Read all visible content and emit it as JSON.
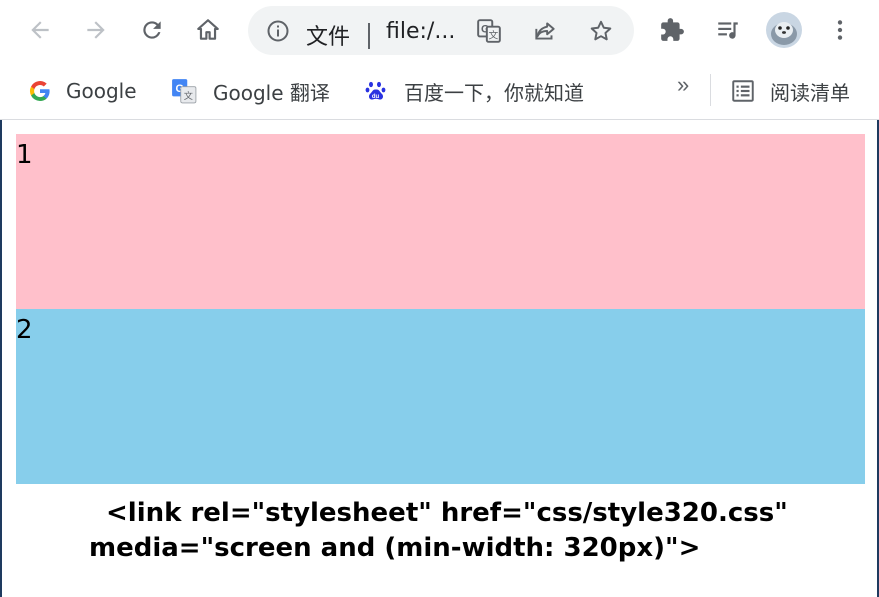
{
  "toolbar": {
    "back_icon": "arrow-left-icon",
    "forward_icon": "arrow-right-icon",
    "reload_icon": "reload-icon",
    "home_icon": "home-icon",
    "omnibox": {
      "info_icon": "info-icon",
      "scheme_label": "文件",
      "url_text": "file:/...",
      "translate_icon": "translate-icon",
      "share_icon": "share-icon",
      "bookmark_star_icon": "star-icon"
    },
    "extensions_icon": "puzzle-icon",
    "media_icon": "media-playlist-icon",
    "avatar_icon": "profile-avatar",
    "menu_icon": "kebab-menu-icon"
  },
  "bookmarks": {
    "items": [
      {
        "label": "Google",
        "icon": "google-icon"
      },
      {
        "label": "Google 翻译",
        "icon": "google-translate-icon"
      },
      {
        "label": "百度一下，你就知道",
        "icon": "baidu-icon"
      }
    ],
    "overflow_label": "»",
    "reading_list_label": "阅读清单",
    "reading_list_icon": "reading-list-icon"
  },
  "page": {
    "box1_text": "1",
    "box1_color": "#ffc0cb",
    "box2_text": "2",
    "box2_color": "#87ceeb",
    "code_line1": "<link rel=\"stylesheet\" href=\"css/style320.css\"",
    "code_line2": "media=\"screen and (min-width: 320px)\">"
  }
}
